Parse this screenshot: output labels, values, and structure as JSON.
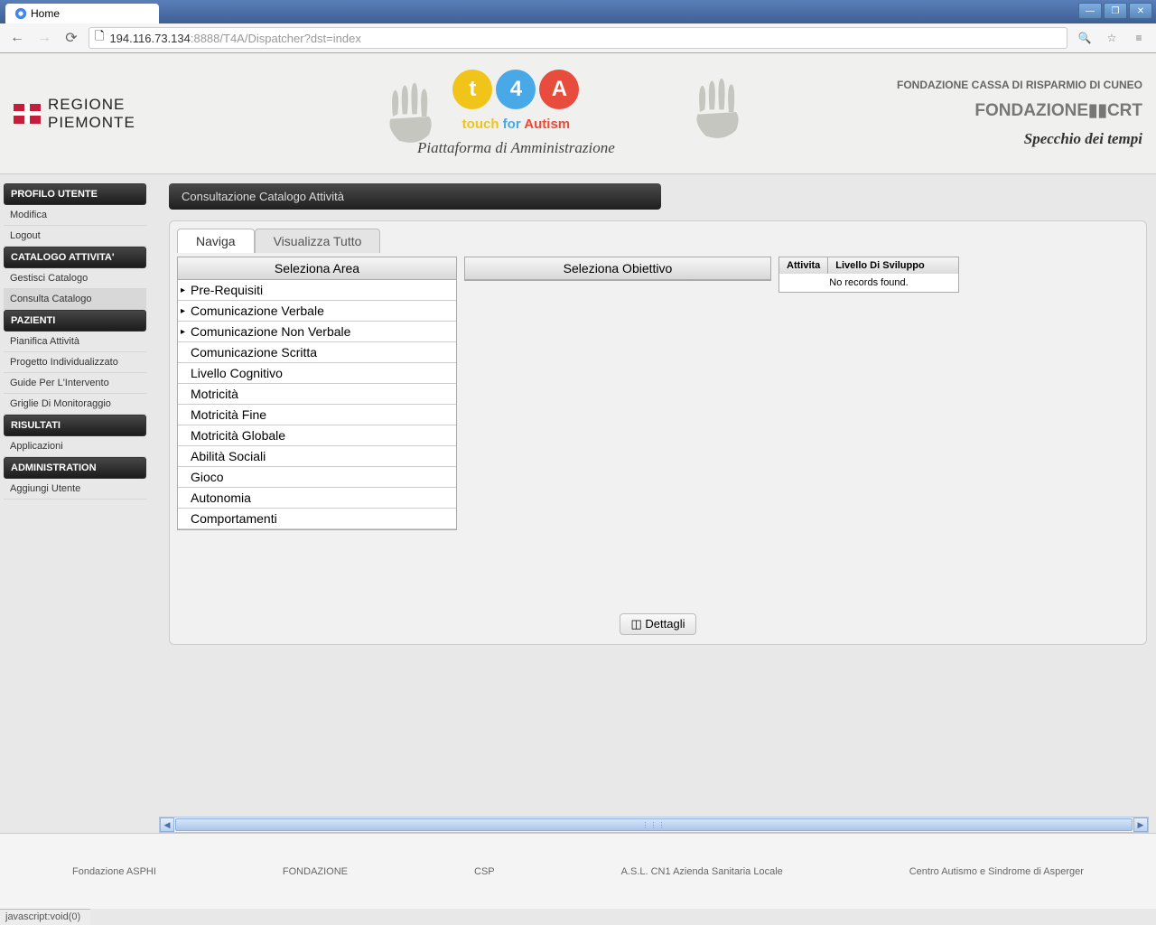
{
  "browser": {
    "tab_title": "Home",
    "url_host": "194.116.73.134",
    "url_path": ":8888/T4A/Dispatcher?dst=index",
    "status_text": "javascript:void(0)"
  },
  "header": {
    "regione_l1": "REGIONE",
    "regione_l2": "PIEMONTE",
    "logo_t": "t",
    "logo_4": "4",
    "logo_a": "A",
    "tagline_t": "touch",
    "tagline_f": "for",
    "tagline_a": "Autism",
    "subtitle": "Piattaforma di Amministrazione",
    "sponsor1": "FONDAZIONE CASSA DI RISPARMIO DI CUNEO",
    "sponsor2": "FONDAZIONE▮▮CRT",
    "sponsor3": "Specchio dei tempi"
  },
  "sidebar": {
    "sections": [
      {
        "header": "PROFILO UTENTE",
        "items": [
          "Modifica",
          "Logout"
        ]
      },
      {
        "header": "CATALOGO ATTIVITA'",
        "items": [
          "Gestisci Catalogo",
          "Consulta Catalogo"
        ]
      },
      {
        "header": "PAZIENTI",
        "items": [
          "Pianifica Attività",
          "Progetto Individualizzato",
          "Guide Per L'Intervento",
          "Griglie Di Monitoraggio"
        ]
      },
      {
        "header": "RISULTATI",
        "items": [
          "Applicazioni"
        ]
      },
      {
        "header": "ADMINISTRATION",
        "items": [
          "Aggiungi Utente"
        ]
      }
    ],
    "active_item": "Consulta Catalogo"
  },
  "content": {
    "panel_title": "Consultazione Catalogo Attività",
    "tabs": [
      "Naviga",
      "Visualizza Tutto"
    ],
    "active_tab": "Naviga",
    "col1_header": "Seleziona Area",
    "col2_header": "Seleziona Obiettivo",
    "areas": [
      {
        "label": "Pre-Requisiti",
        "has_sub": true
      },
      {
        "label": "Comunicazione Verbale",
        "has_sub": true
      },
      {
        "label": "Comunicazione Non Verbale",
        "has_sub": true
      },
      {
        "label": "Comunicazione Scritta",
        "has_sub": false
      },
      {
        "label": "Livello Cognitivo",
        "has_sub": false
      },
      {
        "label": "Motricità",
        "has_sub": false
      },
      {
        "label": "Motricità Fine",
        "has_sub": false
      },
      {
        "label": "Motricità Globale",
        "has_sub": false
      },
      {
        "label": "Abilità Sociali",
        "has_sub": false
      },
      {
        "label": "Gioco",
        "has_sub": false
      },
      {
        "label": "Autonomia",
        "has_sub": false
      },
      {
        "label": "Comportamenti",
        "has_sub": false
      }
    ],
    "table_headers": [
      "Attivita",
      "Livello Di Sviluppo"
    ],
    "no_records": "No records found.",
    "dettagli_btn": "Dettagli"
  },
  "footer": {
    "logos": [
      "Fondazione ASPHI",
      "FONDAZIONE",
      "CSP",
      "A.S.L. CN1 Azienda Sanitaria Locale",
      "Centro Autismo e Sindrome di Asperger"
    ]
  }
}
